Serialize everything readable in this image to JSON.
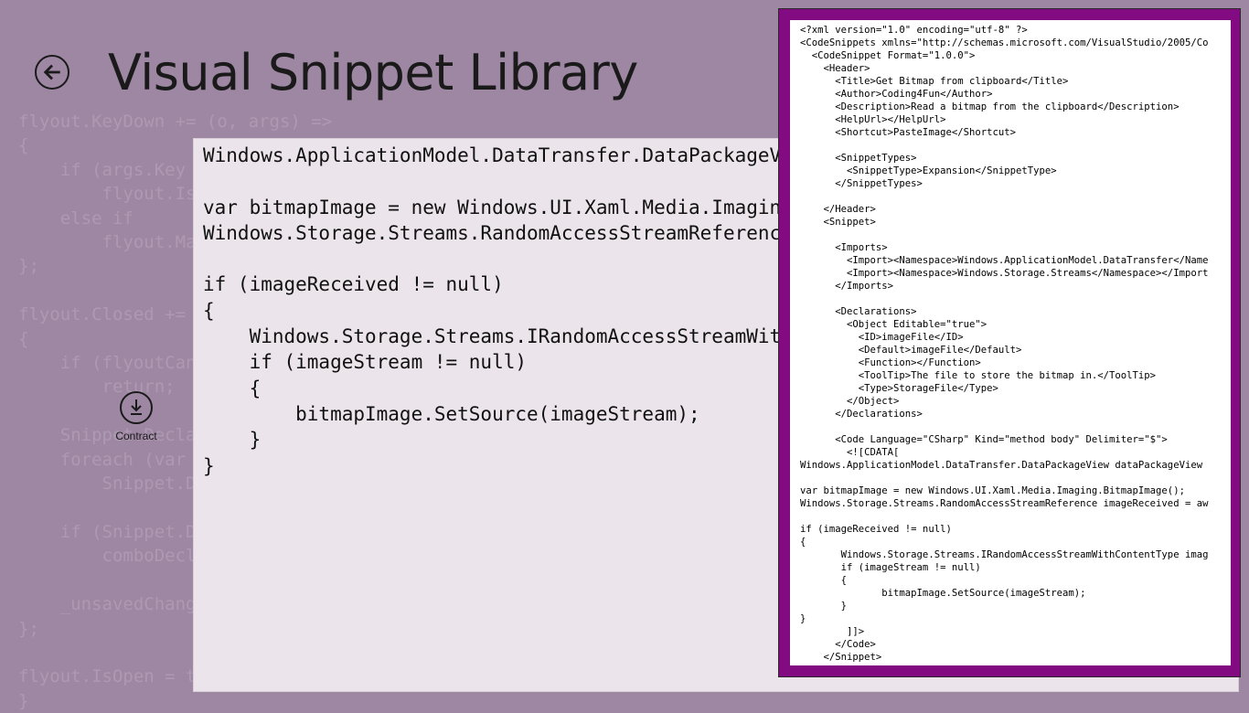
{
  "header": {
    "title": "Visual Snippet Library",
    "back_icon": "back-arrow-icon"
  },
  "background_code": "flyout.KeyDown += (o, args) =>\n{\n    if (args.Key == VirtualKey.Escape)\n        flyout.IsOpen = false;\n    else if\n        flyout.Margin = false;\n};\n\nflyout.Closed += (o, e) =>\n{\n    if (flyoutCanceled)\n        return;\n\n    Snippet.DeclarationList.Clear();\n    foreach (var declaration in tmpCollection)\n        Snippet.DeclarationList.Add(declaration);\n\n    if (Snippet.DeclarationList.Count > 0)\n        comboDeclarations.SelectedIndex = 0;\n\n    _unsavedChanges = true;\n};\n\nflyout.IsOpen = true;\n}",
  "contract_button": {
    "label": "Contract",
    "icon": "download-arrow-icon"
  },
  "code_panel": {
    "code": "Windows.ApplicationModel.DataTransfer.DataPackageView dataPackageView\n\nvar bitmapImage = new Windows.UI.Xaml.Media.Imaging.BitmapImage();\nWindows.Storage.Streams.RandomAccessStreamReference imageReceived = aw\n\nif (imageReceived != null)\n{\n    Windows.Storage.Streams.IRandomAccessStreamWithContentType imag\n    if (imageStream != null)\n    {\n        bitmapImage.SetSource(imageStream);\n    }\n}"
  },
  "xml_panel": {
    "accent_color": "#820b82",
    "content": "<?xml version=\"1.0\" encoding=\"utf-8\" ?>\n<CodeSnippets xmlns=\"http://schemas.microsoft.com/VisualStudio/2005/Co\n  <CodeSnippet Format=\"1.0.0\">\n    <Header>\n      <Title>Get Bitmap from clipboard</Title>\n      <Author>Coding4Fun</Author>\n      <Description>Read a bitmap from the clipboard</Description>\n      <HelpUrl></HelpUrl>\n      <Shortcut>PasteImage</Shortcut>\n\n      <SnippetTypes>\n        <SnippetType>Expansion</SnippetType>\n      </SnippetTypes>\n\n    </Header>\n    <Snippet>\n\n      <Imports>\n        <Import><Namespace>Windows.ApplicationModel.DataTransfer</Name\n        <Import><Namespace>Windows.Storage.Streams</Namespace></Import\n      </Imports>\n\n      <Declarations>\n        <Object Editable=\"true\">\n          <ID>imageFile</ID>\n          <Default>imageFile</Default>\n          <Function></Function>\n          <ToolTip>The file to store the bitmap in.</ToolTip>\n          <Type>StorageFile</Type>\n        </Object>\n      </Declarations>\n\n      <Code Language=\"CSharp\" Kind=\"method body\" Delimiter=\"$\">\n        <![CDATA[\nWindows.ApplicationModel.DataTransfer.DataPackageView dataPackageView\n\nvar bitmapImage = new Windows.UI.Xaml.Media.Imaging.BitmapImage();\nWindows.Storage.Streams.RandomAccessStreamReference imageReceived = aw\n\nif (imageReceived != null)\n{\n       Windows.Storage.Streams.IRandomAccessStreamWithContentType imag\n       if (imageStream != null)\n       {\n              bitmapImage.SetSource(imageStream);\n       }\n}\n        ]]>\n      </Code>\n    </Snippet>"
  }
}
